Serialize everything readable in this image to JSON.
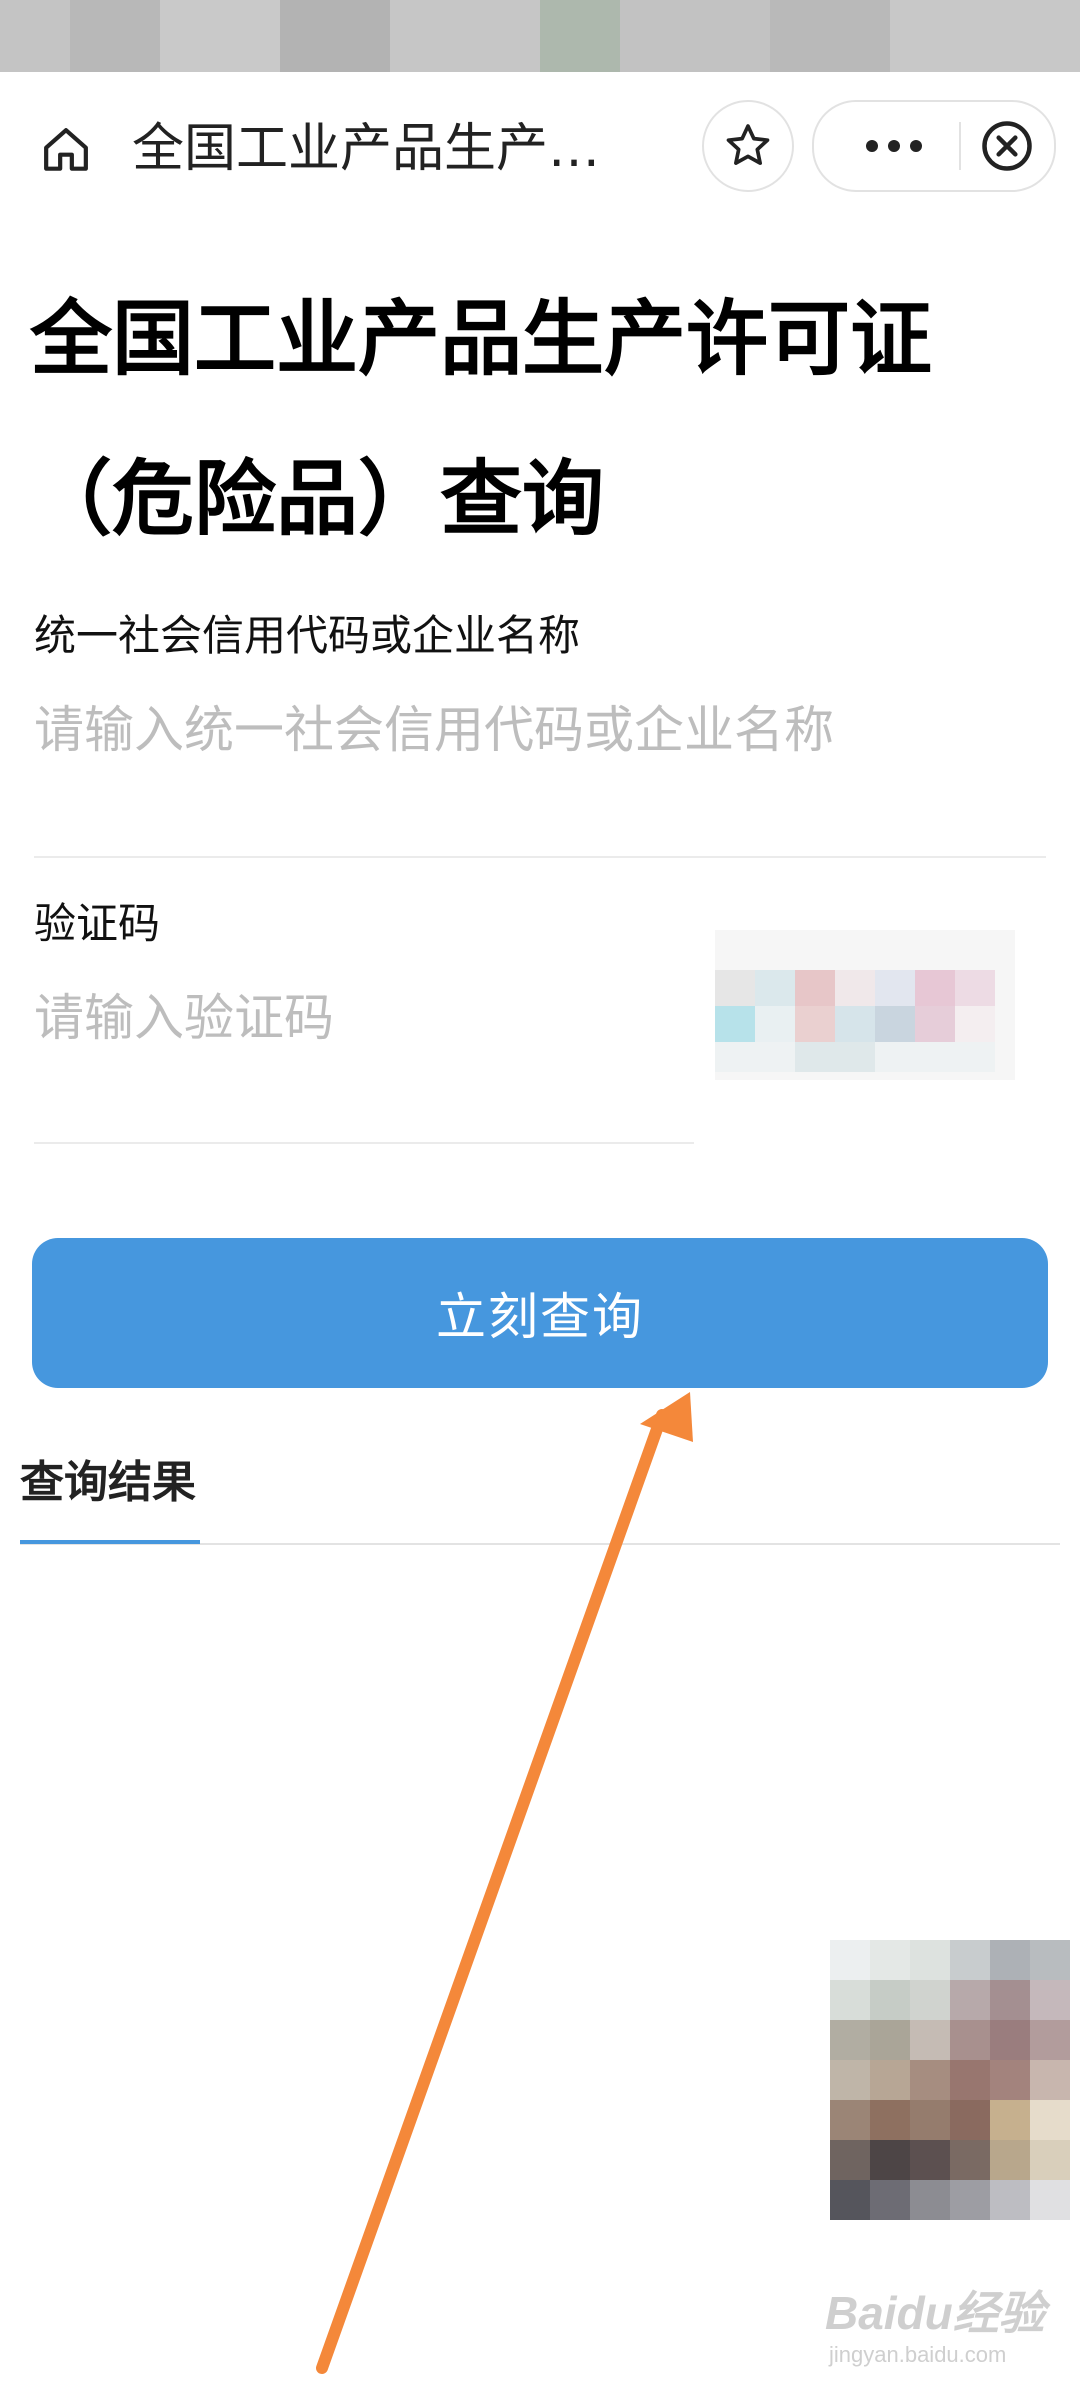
{
  "navbar": {
    "title": "全国工业产品生产…",
    "icons": {
      "home": "home-icon",
      "favorite": "star-icon",
      "more": "more-icon",
      "close": "close-icon"
    }
  },
  "page": {
    "title": "全国工业产品生产许可证（危险品）查询"
  },
  "form": {
    "credit_label": "统一社会信用代码或企业名称",
    "credit_placeholder": "请输入统一社会信用代码或企业名称",
    "captcha_label": "验证码",
    "captcha_placeholder": "请输入验证码",
    "submit_label": "立刻查询"
  },
  "results": {
    "tab_label": "查询结果"
  },
  "watermark": {
    "main": "Baidu经验",
    "sub": "jingyan.baidu.com"
  },
  "colors": {
    "accent": "#4697de",
    "annotation_arrow": "#f4883a",
    "placeholder": "#bdbdbd"
  }
}
